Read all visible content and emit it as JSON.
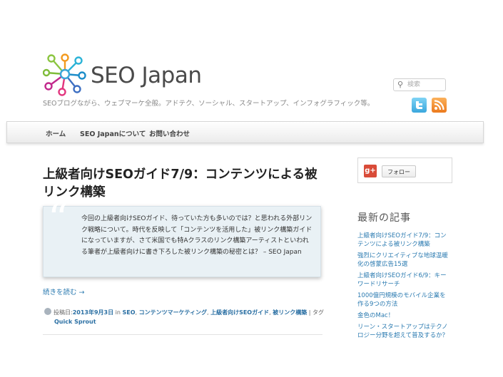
{
  "header": {
    "logo_text": "SEO Japan",
    "tagline": "SEOブログながら、ウェブマーケ全般。アドテク、ソーシャル、スタートアップ、インフォグラフィック等。",
    "search_placeholder": "検索",
    "search_icon": "search-icon"
  },
  "social": {
    "twitter_icon": "twitter-icon",
    "rss_icon": "rss-icon"
  },
  "nav": {
    "items": [
      "ホーム",
      "SEO Japanについて",
      "お問い合わせ"
    ]
  },
  "post": {
    "title": "上級者向けSEOガイド7/9：コンテンツによる被リンク構築",
    "excerpt": "今回の上級者向けSEOガイド、待っていた方も多いのでは？と思われる外部リンク戦略について。時代を反映して「コンテンツを活用した」被リンク構築ガイドになっていますが、さて米国でも特Aクラスのリンク構築アーティストといわれる筆者が上級者向けに書き下ろした被リンク構築の秘密とは？ – SEO Japan",
    "quote_mark": "“",
    "read_more": "続きを読む →",
    "meta": {
      "posted_label": "投稿日:",
      "date": "2013年9月3日",
      "in_label": "in",
      "categories": [
        "SEO",
        "コンテンツマーケティング",
        "上級者向けSEOガイド",
        "被リンク構築"
      ],
      "tag_label": "| タグ",
      "tag": "Quick Sprout"
    }
  },
  "sidebar": {
    "gplus_label": "g+",
    "follow_label": "フォロー",
    "recent_heading": "最新の記事",
    "recent_posts": [
      "上級者向けSEOガイド7/9：コンテンツによる被リンク構築",
      "強烈にクリエイティブな地球温暖化の啓蒙広告15選",
      "上級者向けSEOガイド6/9：キーワードリサーチ",
      "1000億円規模のモバイル企業を作る9つの方法",
      "金色のMac！",
      "リーン・スタートアップはテクノロジー分野を超えて普及するか？"
    ]
  },
  "colors": {
    "accent_link": "#2a7ab0",
    "excerpt_bg": "#e9f1f5",
    "gplus_red": "#d94b38",
    "twitter_blue": "#3aa7dd",
    "rss_orange": "#ec7a1d"
  }
}
